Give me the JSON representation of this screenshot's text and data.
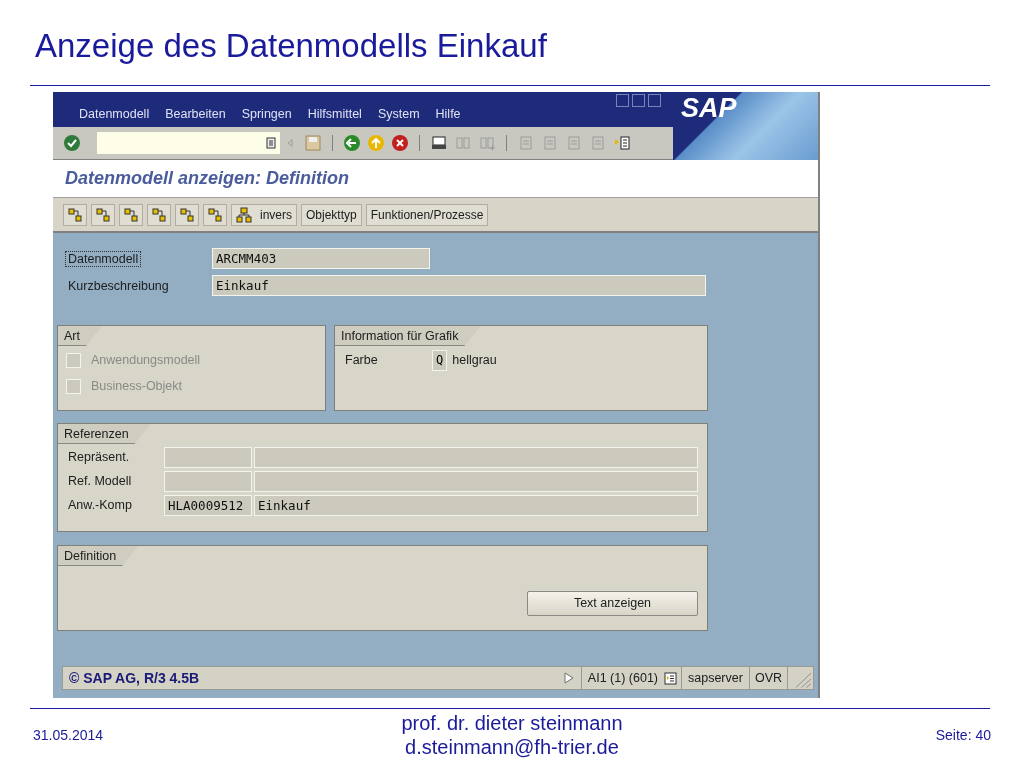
{
  "slide": {
    "title": "Anzeige des Datenmodells Einkauf"
  },
  "window": {
    "menu": [
      "Datenmodell",
      "Bearbeiten",
      "Springen",
      "Hilfsmittel",
      "System",
      "Hilfe"
    ],
    "logo": "SAP",
    "screen_title": "Datenmodell anzeigen: Definition",
    "app_buttons": [
      {
        "label": "invers",
        "kind": "icon_text"
      },
      {
        "label": "Objekttyp",
        "kind": "text"
      },
      {
        "label": "Funktionen/Prozesse",
        "kind": "text"
      }
    ],
    "fields": [
      {
        "label": "Datenmodell",
        "value": "ARCMM403",
        "focused": true
      },
      {
        "label": "Kurzbeschreibung",
        "value": "Einkauf",
        "focused": false
      }
    ],
    "art": {
      "title": "Art",
      "options": [
        {
          "label": "Anwendungsmodell",
          "checked": false,
          "disabled": true
        },
        {
          "label": "Business-Objekt",
          "checked": false,
          "disabled": true
        }
      ]
    },
    "grafik": {
      "title": "Information für Grafik",
      "label": "Farbe",
      "code": "Q",
      "value": "hellgrau"
    },
    "referenzen": {
      "title": "Referenzen",
      "rows": [
        {
          "label": "Repräsent."
        },
        {
          "label": "Ref. Modell"
        },
        {
          "label": "Anw.-Komp",
          "code": "HLA0009512",
          "text": "Einkauf"
        }
      ]
    },
    "definition": {
      "title": "Definition",
      "button": "Text anzeigen"
    },
    "status_bar": {
      "message": "© SAP AG, R/3 4.5B",
      "session": "AI1 (1) (601)",
      "server": "sapserver",
      "mode": "OVR"
    }
  },
  "footer": {
    "date": "31.05.2014",
    "author": "prof. dr. dieter steinmann",
    "email": "d.steinmann@fh-trier.de",
    "page": "Seite: 40"
  }
}
